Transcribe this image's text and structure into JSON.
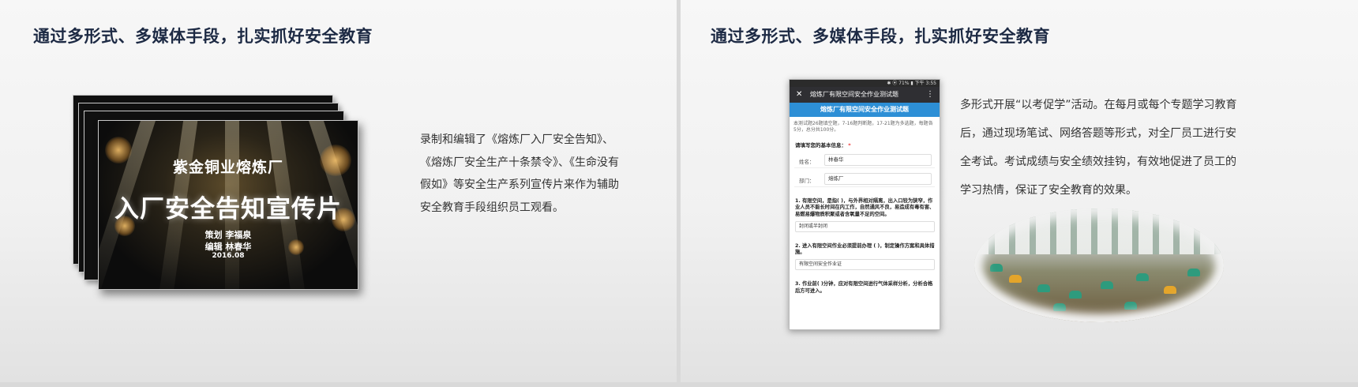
{
  "left_slide": {
    "title": "通过多形式、多媒体手段，扎实抓好安全教育",
    "cover": {
      "subtitle": "紫金铜业熔炼厂",
      "headline": "入厂安全告知宣传片",
      "credit_planner": "策划  李福泉",
      "credit_editor": "编辑  林春华",
      "date": "2016.08"
    },
    "description": "录制和编辑了《熔炼厂入厂安全告知》、《熔炼厂安全生产十条禁令》、《生命没有假如》等安全生产系列宣传片来作为辅助安全教育手段组织员工观看。"
  },
  "right_slide": {
    "title": "通过多形式、多媒体手段，扎实抓好安全教育",
    "phone": {
      "status_text": "✱ ⦿ 71% ▮ 下午 3:55",
      "appbar_close": "✕",
      "appbar_title": "熔炼厂有限空间安全作业测试题",
      "appbar_more": "⋮",
      "banner": "熔炼厂有限空间安全作业测试题",
      "intro": "本测试题26题填空题，7-16题判断题，17-21题为多选题，每题各5分，总分共100分。",
      "basic_info_label": "请填写您的基本信息：",
      "required_mark": "*",
      "name_label": "姓名：",
      "name_value": "林春华",
      "dept_label": "部门：",
      "dept_value": "熔炼厂",
      "q1": "1. 有限空间，是指( )，与外界相对隔离，出入口较为狭窄，作业人员不能长时间在内工作，自然通风不良，易造成有毒有害、易燃易爆物质积聚或者含氧量不足的空间。",
      "a1": "封闭或半封闭",
      "q2": "2. 进入有限空间作业必须提前办理 ( )，制定操作方案和具体措施。",
      "a2": "有限空间安全作业证",
      "q3": "3. 作业前( )分钟，应对有限空间进行气体采样分析，分析合格后方可进入。"
    },
    "description": "多形式开展“以考促学”活动。在每月或每个专题学习教育后，通过现场笔试、网络答题等形式，对全厂员工进行安全考试。考试成绩与安全绩效挂钩，有效地促进了员工的学习热情，保证了安全教育的效果。"
  },
  "colors": {
    "title": "#1d2a44",
    "banner": "#2d8fd6",
    "chair_green": "#2e9b7d",
    "chair_yellow": "#e4a52a"
  }
}
